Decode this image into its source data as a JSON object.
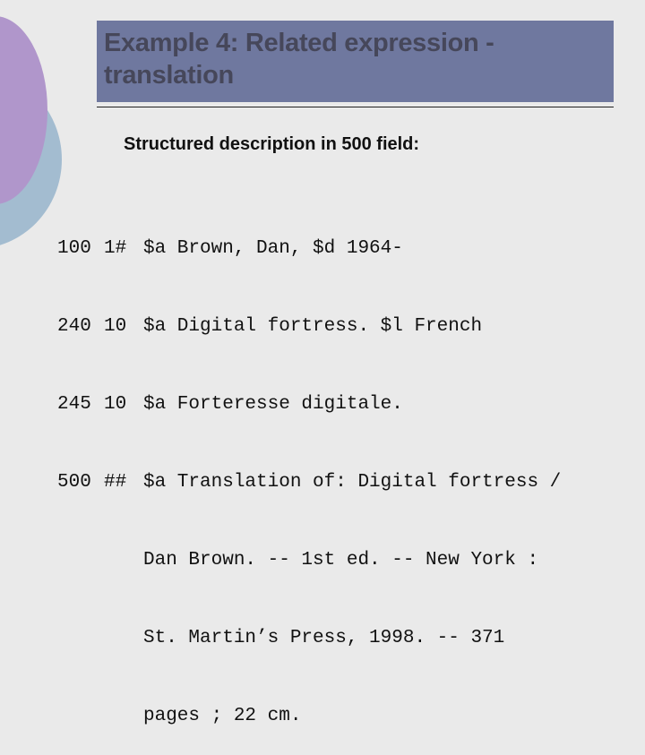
{
  "slide": {
    "title": "Example 4: Related expression - translation",
    "subtitle": "Structured description in 500 field:",
    "colors": {
      "background": "#eaeaea",
      "title_bar": "#6f789f",
      "title_text": "#46475a",
      "circle_purple": "#b096cb",
      "circle_blue": "#a3bcd0"
    }
  },
  "marc_fields": [
    {
      "tag": "100",
      "indicators": "1#",
      "content": "$a Brown, Dan, $d 1964-"
    },
    {
      "tag": "240",
      "indicators": "10",
      "content": "$a Digital fortress. $l French"
    },
    {
      "tag": "245",
      "indicators": "10",
      "content": "$a Forteresse digitale."
    },
    {
      "tag": "500",
      "indicators": "##",
      "content": "$a Translation of: Digital fortress /"
    }
  ],
  "marc_500_continuation": [
    "Dan Brown. -- 1st ed. -- New York :",
    "St. Martin’s Press, 1998. -- 371",
    "pages ; 22 cm."
  ]
}
